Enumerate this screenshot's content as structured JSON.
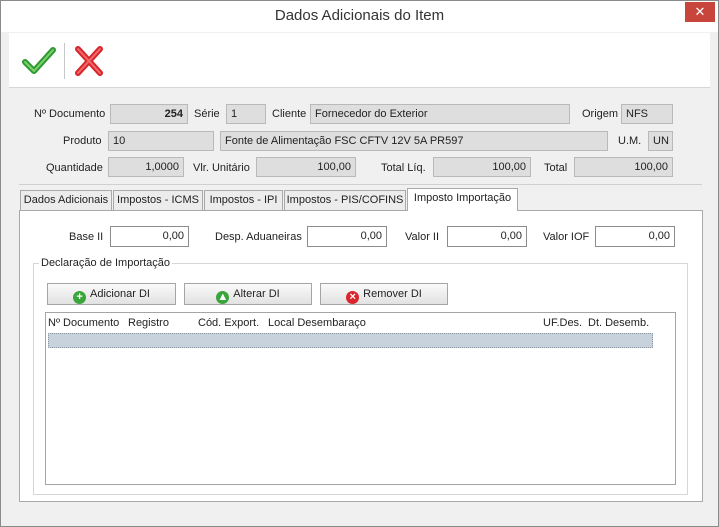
{
  "window": {
    "title": "Dados Adicionais do Item",
    "close_glyph": "✕"
  },
  "toolbar": {
    "confirm_icon": "check-icon",
    "cancel_icon": "x-icon"
  },
  "header": {
    "documento_label": "Nº Documento",
    "documento": "254",
    "serie_label": "Série",
    "serie": "1",
    "cliente_label": "Cliente",
    "cliente": "Fornecedor do Exterior",
    "origem_label": "Origem",
    "origem": "NFS",
    "produto_label": "Produto",
    "produto_codigo": "10",
    "produto_descricao": "Fonte de Alimentação FSC CFTV 12V 5A PR597",
    "um_label": "U.M.",
    "um": "UN",
    "quantidade_label": "Quantidade",
    "quantidade": "1,0000",
    "vlr_unitario_label": "Vlr. Unitário",
    "vlr_unitario": "100,00",
    "total_liq_label": "Total Líq.",
    "total_liq": "100,00",
    "total_label": "Total",
    "total": "100,00"
  },
  "tabs": [
    {
      "label": "Dados Adicionais",
      "active": false
    },
    {
      "label": "Impostos - ICMS",
      "active": false
    },
    {
      "label": "Impostos - IPI",
      "active": false
    },
    {
      "label": "Impostos - PIS/COFINS",
      "active": false
    },
    {
      "label": "Imposto Importação",
      "active": true
    }
  ],
  "importacao": {
    "base_ii_label": "Base II",
    "base_ii": "0,00",
    "desp_aduaneiras_label": "Desp. Aduaneiras",
    "desp_aduaneiras": "0,00",
    "valor_ii_label": "Valor II",
    "valor_ii": "0,00",
    "valor_iof_label": "Valor IOF",
    "valor_iof": "0,00"
  },
  "declaracao": {
    "title": "Declaração de Importação",
    "add_label": "Adicionar DI",
    "alter_label": "Alterar DI",
    "remove_label": "Remover DI",
    "columns": [
      "Nº Documento",
      "Registro",
      "Cód. Export.",
      "Local Desembaraço",
      "UF.Des.",
      "Dt. Desemb."
    ],
    "rows": []
  },
  "colors": {
    "confirm": "#3aa53a",
    "cancel": "#d9262e",
    "close": "#c7453a",
    "selection": "#c7d2dc"
  }
}
